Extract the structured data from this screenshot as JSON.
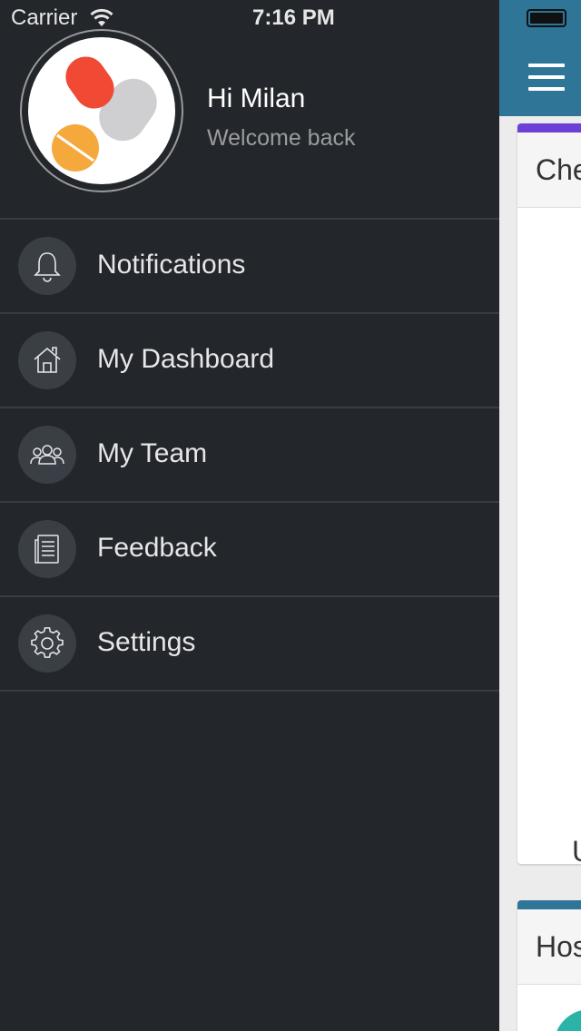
{
  "status_bar": {
    "carrier": "Carrier",
    "time": "7:16 PM"
  },
  "profile": {
    "greeting": "Hi Milan",
    "subtitle": "Welcome back"
  },
  "menu": {
    "items": [
      {
        "label": "Notifications",
        "icon": "bell-icon"
      },
      {
        "label": "My Dashboard",
        "icon": "home-icon"
      },
      {
        "label": "My Team",
        "icon": "team-icon"
      },
      {
        "label": "Feedback",
        "icon": "document-icon"
      },
      {
        "label": "Settings",
        "icon": "gear-icon"
      }
    ]
  },
  "main": {
    "card1_title": "Che",
    "card1_letter": "U",
    "card2_title": "Hos"
  },
  "colors": {
    "drawer_bg": "#23262b",
    "header_bg": "#2f7597",
    "card1_accent": "#6c3fd6",
    "card2_accent": "#2f7597",
    "teal": "#2bb3a8"
  }
}
